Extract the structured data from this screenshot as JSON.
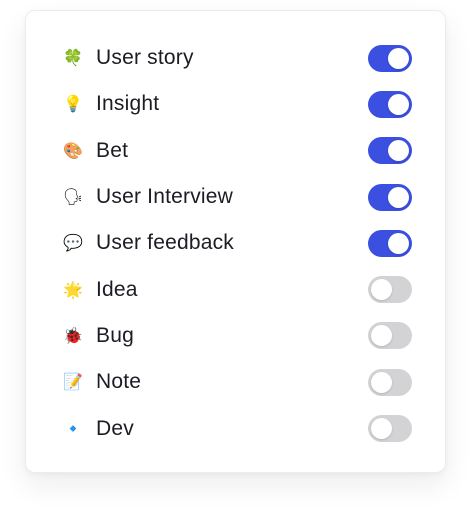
{
  "colors": {
    "toggle_on": "#3b4fe0",
    "toggle_off": "#d3d3d6",
    "text": "#1c1c24"
  },
  "items": [
    {
      "label": "User story",
      "icon": "shamrock-icon",
      "glyph": "🍀",
      "enabled": true
    },
    {
      "label": "Insight",
      "icon": "lightbulb-icon",
      "glyph": "💡",
      "enabled": true
    },
    {
      "label": "Bet",
      "icon": "palette-icon",
      "glyph": "🎨",
      "enabled": true
    },
    {
      "label": "User Interview",
      "icon": "speaking-head-icon",
      "glyph": "🗣",
      "enabled": true
    },
    {
      "label": "User feedback",
      "icon": "speech-bubble-icon",
      "glyph": "💬",
      "enabled": true
    },
    {
      "label": "Idea",
      "icon": "glowing-star-icon",
      "glyph": "🌟",
      "enabled": false
    },
    {
      "label": "Bug",
      "icon": "ladybug-icon",
      "glyph": "🐞",
      "enabled": false
    },
    {
      "label": "Note",
      "icon": "memo-icon",
      "glyph": "📝",
      "enabled": false
    },
    {
      "label": "Dev",
      "icon": "blue-diamond-icon",
      "glyph": "🔹",
      "enabled": false
    }
  ]
}
